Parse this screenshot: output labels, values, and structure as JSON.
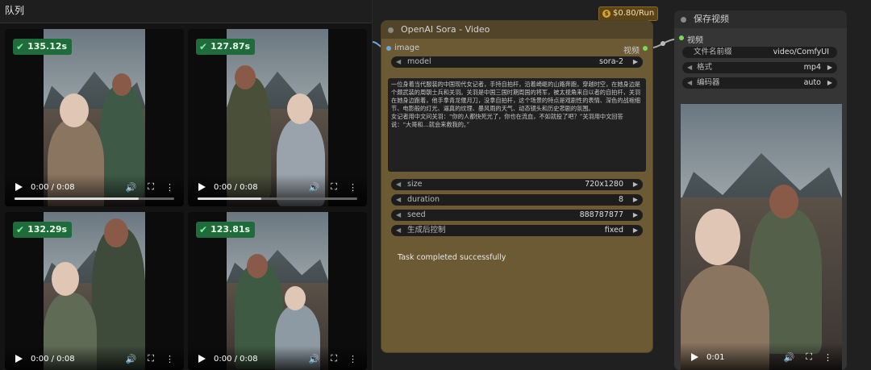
{
  "queue": {
    "title": "队列",
    "tiles": [
      {
        "duration_badge": "135.12s",
        "time": "0:00 / 0:08",
        "progress": 0.78
      },
      {
        "duration_badge": "127.87s",
        "time": "0:00 / 0:08",
        "progress": 0.4
      },
      {
        "duration_badge": "132.29s",
        "time": "0:00 / 0:08",
        "progress": 0.0
      },
      {
        "duration_badge": "123.81s",
        "time": "0:00 / 0:08",
        "progress": 0.0
      }
    ]
  },
  "price_badge": {
    "icon": "dollar-coin-icon",
    "label": "$0.80/Run"
  },
  "sora_node": {
    "title": "OpenAI Sora - Video",
    "input_label": "image",
    "output_label": "视频",
    "model": {
      "label": "model",
      "value": "sora-2"
    },
    "prompt": "一位身着当代服装的中国现代女记者，手持自拍杆，沿着崎岖的山路奔跑，穿越时空，在她身边是个颇武装的周朝士兵和关羽。关羽是中国三国时期周国的将军，被太视角来自以者的自拍杆，关羽在她身边跑着，他手拿青龙偃月刀，没拿自拍杆，这个场景的特点是戏剧性的表情、深色的战袍细节、电影般的灯光、逼真的纹理、暴风雨的天气、动态镜头和历史悲剧的氛围。\n女记者用中文问关羽：“你的人都快死光了，你也在流血，不如就投了吧？”关羽用中文回答说：“大哥和…就会来救我的。”",
    "size": {
      "label": "size",
      "value": "720x1280"
    },
    "duration": {
      "label": "duration",
      "value": "8"
    },
    "seed": {
      "label": "seed",
      "value": "888787877"
    },
    "control": {
      "label": "生成后控制",
      "value": "fixed"
    },
    "status": "Task completed successfully"
  },
  "save_node": {
    "title": "保存视频",
    "input_label": "视频",
    "prefix": {
      "label": "文件名前缀",
      "value": "video/ComfyUI"
    },
    "format": {
      "label": "格式",
      "value": "mp4"
    },
    "codec": {
      "label": "编码器",
      "value": "auto"
    },
    "video_time": "0:01"
  },
  "colors": {
    "sora_node_bg": "#6b5a33",
    "badge_green": "#1f6b3b",
    "output_pin": "#7ed957",
    "input_pin": "#6fa8dc"
  }
}
